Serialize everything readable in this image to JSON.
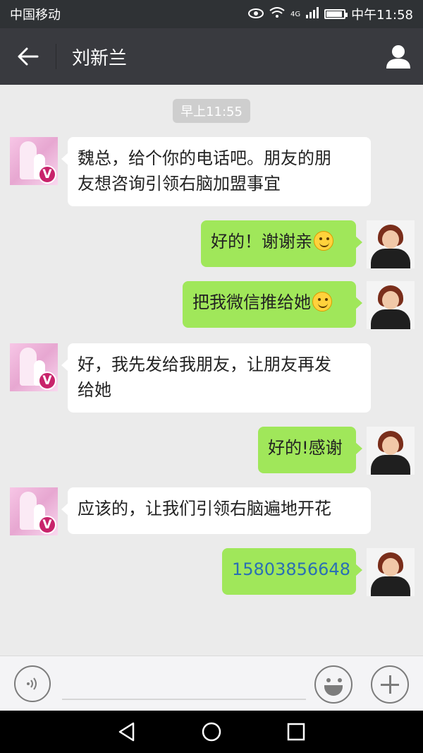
{
  "status_bar": {
    "carrier": "中国移动",
    "network": "4G",
    "time": "中午11:58",
    "icons": [
      "eye-icon",
      "wifi-icon",
      "signal-icon",
      "battery-icon"
    ],
    "battery_level": 0.9
  },
  "header": {
    "title": "刘新兰",
    "back_icon": "back-arrow-icon",
    "profile_icon": "profile-icon"
  },
  "chat": {
    "time_divider": "早上11:55",
    "messages": [
      {
        "side": "left",
        "line1": "魏总，给个你的电话吧。朋友的朋",
        "line2": "友想咨询引领右脑加盟事宜"
      },
      {
        "side": "right",
        "text": "好的！谢谢亲",
        "emoji": "smile-emoji"
      },
      {
        "side": "right",
        "text": "把我微信推给她",
        "emoji": "smile-emoji"
      },
      {
        "side": "left",
        "line1": "好，我先发给我朋友，让朋友再发",
        "line2": "给她"
      },
      {
        "side": "right",
        "text": "好的!感谢"
      },
      {
        "side": "left",
        "text": "应该的，让我们引领右脑遍地开花"
      },
      {
        "side": "right",
        "text": "15803856648",
        "is_link": true
      }
    ]
  },
  "input_bar": {
    "value": "",
    "voice_icon": "voice-icon",
    "emoji_icon": "emoji-icon",
    "plus_icon": "plus-icon"
  },
  "nav_bar": {
    "icons": [
      "back-triangle-icon",
      "home-circle-icon",
      "recents-square-icon"
    ]
  },
  "colors": {
    "bubble_sent": "#a0e75a",
    "bubble_received": "#ffffff",
    "chat_background": "#ebebeb",
    "title_bar": "#393a3f"
  }
}
